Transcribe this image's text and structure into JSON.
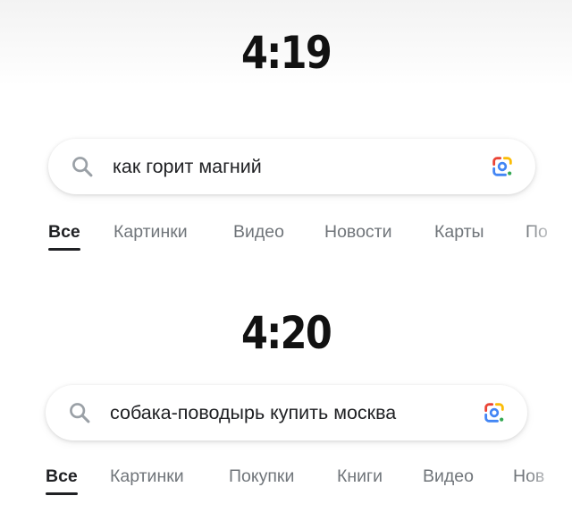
{
  "screen1": {
    "time": "4:19",
    "search": {
      "query": "как горит магний"
    },
    "tabs": [
      {
        "label": "Все",
        "active": true
      },
      {
        "label": "Картинки"
      },
      {
        "label": "Видео"
      },
      {
        "label": "Новости"
      },
      {
        "label": "Карты"
      },
      {
        "label": "По"
      }
    ]
  },
  "screen2": {
    "time": "4:20",
    "search": {
      "query": "собака-поводырь купить москва"
    },
    "tabs": [
      {
        "label": "Все",
        "active": true
      },
      {
        "label": "Картинки"
      },
      {
        "label": "Покупки"
      },
      {
        "label": "Книги"
      },
      {
        "label": "Видео"
      },
      {
        "label": "Нов"
      }
    ]
  },
  "icons": {
    "search": "search-icon",
    "lens": "google-lens-icon"
  },
  "colors": {
    "lens_blue": "#4285F4",
    "lens_red": "#EA4335",
    "lens_yellow": "#FBBC05",
    "lens_green": "#34A853",
    "active_tab": "#202124",
    "inactive_tab": "#70757a"
  }
}
